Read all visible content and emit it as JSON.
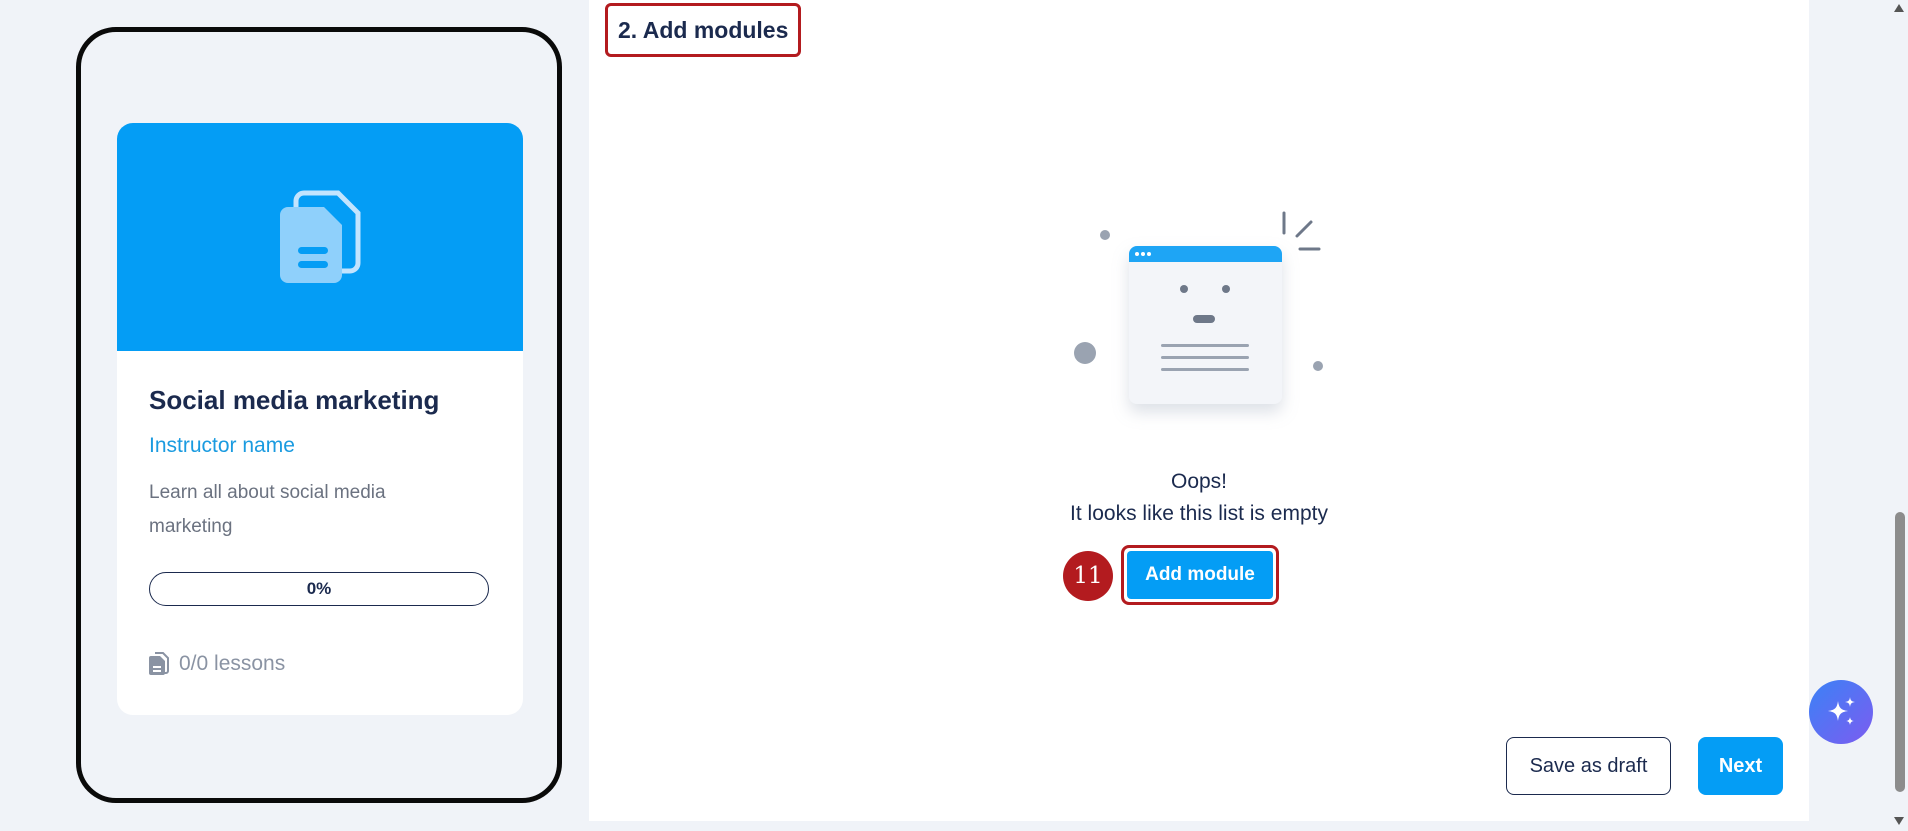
{
  "preview": {
    "title": "Social media marketing",
    "instructor": "Instructor name",
    "description": "Learn all about social media marketing",
    "progress": "0%",
    "progress_value": 0,
    "lessons": "0/0 lessons",
    "cover_color": "#049df5",
    "cover_icon": "documents-icon"
  },
  "section": {
    "title": "2. Add modules"
  },
  "empty_state": {
    "line1": "Oops!",
    "line2": "It looks like this list is empty",
    "illustration": "empty-window-illustration"
  },
  "actions": {
    "step_number": "11",
    "add_module": "Add module",
    "save_draft": "Save as draft",
    "next": "Next"
  },
  "colors": {
    "accent": "#049df5",
    "highlight": "#b31b1f",
    "text": "#1b2a4e",
    "ai_gradient": [
      "#3b82f6",
      "#7c5cf0"
    ]
  },
  "icons": {
    "ai": "sparkles-icon",
    "lessons": "document-icon"
  }
}
